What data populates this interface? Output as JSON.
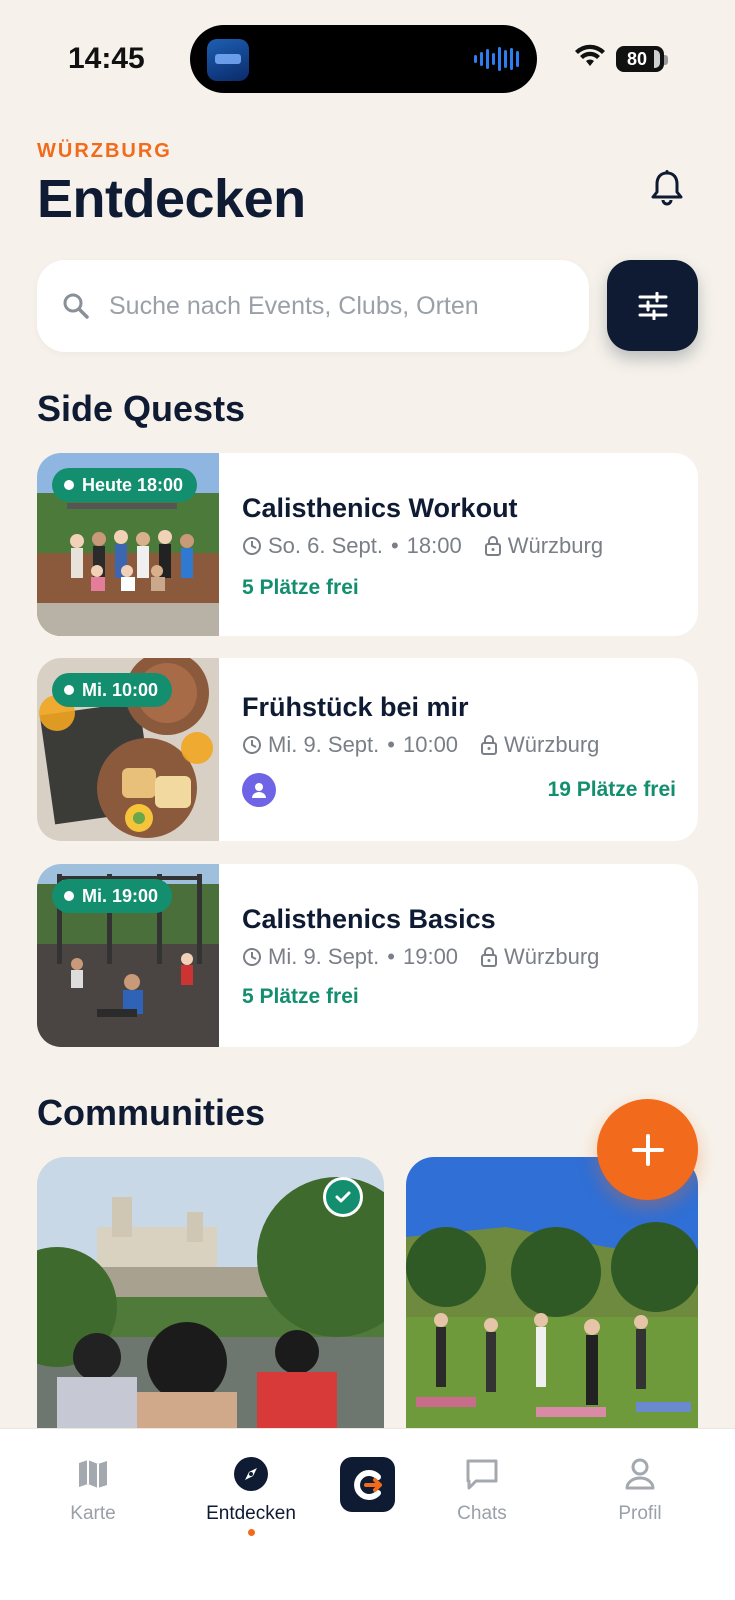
{
  "status_bar": {
    "time": "14:45",
    "battery": "80"
  },
  "header": {
    "city": "WÜRZBURG",
    "title": "Entdecken"
  },
  "search": {
    "placeholder": "Suche nach Events, Clubs, Orten"
  },
  "side_quests": {
    "title": "Side Quests",
    "events": [
      {
        "badge": "Heute 18:00",
        "title": "Calisthenics Workout",
        "date": "So. 6. Sept.",
        "time": "18:00",
        "location": "Würzburg",
        "spots": "5 Plätze frei"
      },
      {
        "badge": "Mi. 10:00",
        "title": "Frühstück bei mir",
        "date": "Mi. 9. Sept.",
        "time": "10:00",
        "location": "Würzburg",
        "spots": "19 Plätze frei"
      },
      {
        "badge": "Mi. 19:00",
        "title": "Calisthenics Basics",
        "date": "Mi. 9. Sept.",
        "time": "19:00",
        "location": "Würzburg",
        "spots": "5 Plätze frei"
      }
    ]
  },
  "communities": {
    "title": "Communities"
  },
  "bottom_nav": {
    "items": [
      {
        "label": "Karte"
      },
      {
        "label": "Entdecken"
      },
      {
        "label": "Chats"
      },
      {
        "label": "Profil"
      }
    ]
  },
  "colors": {
    "accent": "#f26a1b",
    "primary": "#0f1b33",
    "success": "#138f6f",
    "background": "#f6f2eb"
  }
}
